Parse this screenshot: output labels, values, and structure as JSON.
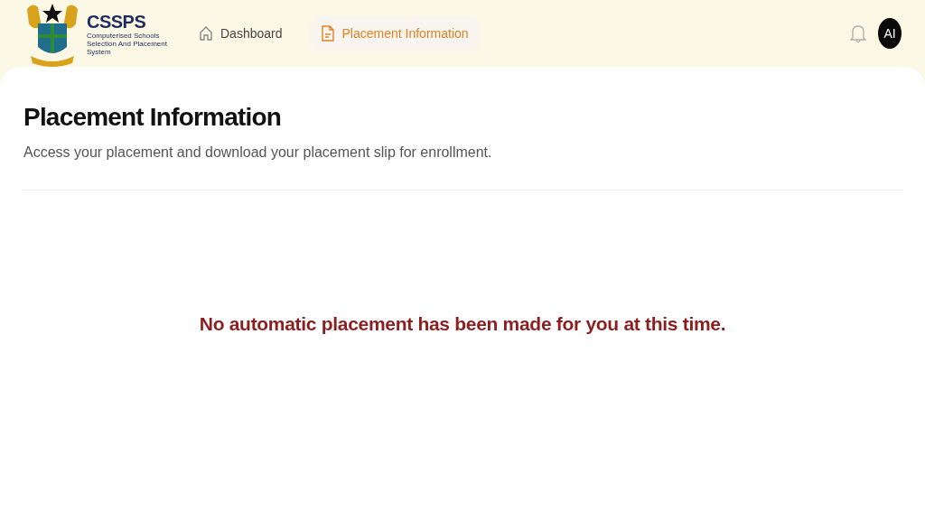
{
  "header": {
    "logo": {
      "title": "CSSPS",
      "subtitle": "Computerised Schools Selection And Placement System"
    },
    "nav": [
      {
        "label": "Dashboard",
        "kind": "home",
        "selected": false
      },
      {
        "label": "Placement Information",
        "kind": "document",
        "selected": true
      }
    ],
    "avatar": "AI"
  },
  "page": {
    "title": "Placement Information",
    "description": "Access your placement and download your placement slip for enrollment.",
    "message": "No automatic placement has been made for you at this time."
  }
}
